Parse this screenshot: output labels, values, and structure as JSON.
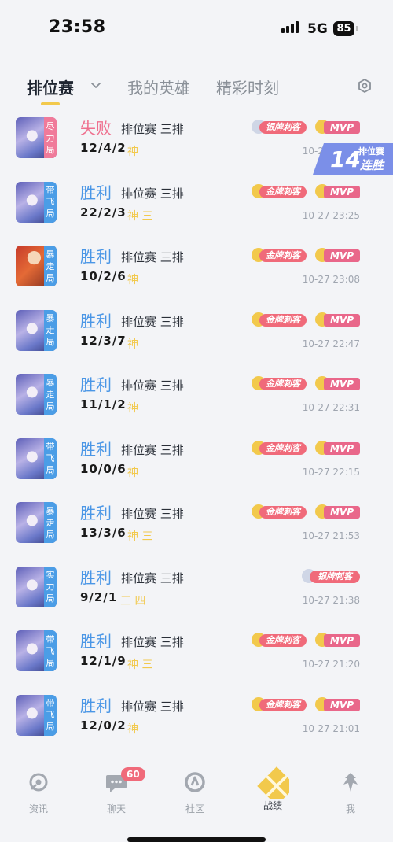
{
  "status_bar": {
    "time": "23:58",
    "network": "5G",
    "battery": "85"
  },
  "tabs": [
    {
      "label": "排位赛",
      "active": true
    },
    {
      "label": "我的英雄",
      "active": false
    },
    {
      "label": "精彩时刻",
      "active": false
    }
  ],
  "icons": {
    "tab_dropdown": "chevron-down-icon",
    "settings": "settings-hexagon-icon"
  },
  "colors": {
    "win": "#4a96e6",
    "loss": "#ef6f8e",
    "accent": "#f2c94c",
    "medal": "#f06a7a"
  },
  "matches": [
    {
      "result": "失败",
      "outcome": "loss",
      "mode": "排位赛 三排",
      "kda": "12/4/2",
      "tags": "神",
      "time": "10-27 23:45",
      "badge": "尽力局",
      "medal": "银牌刺客",
      "mvp": "MVP",
      "hero_style": "silver-hair"
    },
    {
      "result": "胜利",
      "outcome": "win",
      "mode": "排位赛 三排",
      "kda": "22/2/3",
      "tags": "神 三",
      "time": "10-27 23:25",
      "badge": "带飞局",
      "medal": "金牌刺客",
      "mvp": "MVP",
      "hero_style": "silver-hair"
    },
    {
      "result": "胜利",
      "outcome": "win",
      "mode": "排位赛 三排",
      "kda": "10/2/6",
      "tags": "神",
      "time": "10-27 23:08",
      "badge": "暴走局",
      "medal": "金牌刺客",
      "mvp": "MVP",
      "hero_style": "red-hair"
    },
    {
      "result": "胜利",
      "outcome": "win",
      "mode": "排位赛 三排",
      "kda": "12/3/7",
      "tags": "神",
      "time": "10-27 22:47",
      "badge": "暴走局",
      "medal": "金牌刺客",
      "mvp": "MVP",
      "hero_style": "silver-hair"
    },
    {
      "result": "胜利",
      "outcome": "win",
      "mode": "排位赛 三排",
      "kda": "11/1/2",
      "tags": "神",
      "time": "10-27 22:31",
      "badge": "暴走局",
      "medal": "金牌刺客",
      "mvp": "MVP",
      "hero_style": "silver-hair"
    },
    {
      "result": "胜利",
      "outcome": "win",
      "mode": "排位赛 三排",
      "kda": "10/0/6",
      "tags": "神",
      "time": "10-27 22:15",
      "badge": "带飞局",
      "medal": "金牌刺客",
      "mvp": "MVP",
      "hero_style": "silver-hair"
    },
    {
      "result": "胜利",
      "outcome": "win",
      "mode": "排位赛 三排",
      "kda": "13/3/6",
      "tags": "神 三",
      "time": "10-27 21:53",
      "badge": "暴走局",
      "medal": "金牌刺客",
      "mvp": "MVP",
      "hero_style": "silver-hair"
    },
    {
      "result": "胜利",
      "outcome": "win",
      "mode": "排位赛 三排",
      "kda": "9/2/1",
      "tags": "三 四",
      "time": "10-27 21:38",
      "badge": "实力局",
      "medal": "银牌刺客",
      "mvp": "",
      "hero_style": "silver-hair"
    },
    {
      "result": "胜利",
      "outcome": "win",
      "mode": "排位赛 三排",
      "kda": "12/1/9",
      "tags": "神 三",
      "time": "10-27 21:20",
      "badge": "带飞局",
      "medal": "金牌刺客",
      "mvp": "MVP",
      "hero_style": "silver-hair"
    },
    {
      "result": "胜利",
      "outcome": "win",
      "mode": "排位赛 三排",
      "kda": "12/0/2",
      "tags": "神",
      "time": "10-27 21:01",
      "badge": "带飞局",
      "medal": "金牌刺客",
      "mvp": "MVP",
      "hero_style": "silver-hair"
    }
  ],
  "streak": {
    "count": "14",
    "top": "排位赛",
    "bottom": "连胜"
  },
  "bottom_nav": [
    {
      "label": "资讯",
      "icon": "news-icon",
      "active": false
    },
    {
      "label": "聊天",
      "icon": "chat-icon",
      "badge": "60",
      "active": false
    },
    {
      "label": "社区",
      "icon": "community-icon",
      "active": false
    },
    {
      "label": "战绩",
      "icon": "record-swords-icon",
      "active": true
    },
    {
      "label": "我",
      "icon": "profile-icon",
      "active": false
    }
  ]
}
